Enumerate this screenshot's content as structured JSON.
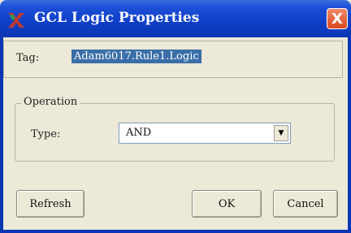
{
  "window": {
    "title": "GCL Logic Properties",
    "close_glyph": "X"
  },
  "tag": {
    "label": "Tag:",
    "value": "Adam6017.Rule1.Logic"
  },
  "operation": {
    "legend": "Operation",
    "type_label": "Type:",
    "type_value": "AND",
    "dropdown_icon": "chevron-down-icon"
  },
  "buttons": {
    "refresh": "Refresh",
    "ok": "OK",
    "cancel": "Cancel"
  },
  "colors": {
    "titlebar": "#0f3fc7",
    "selection": "#3a6ea8",
    "close": "#d9481c",
    "dialog_bg": "#ece9d8"
  }
}
